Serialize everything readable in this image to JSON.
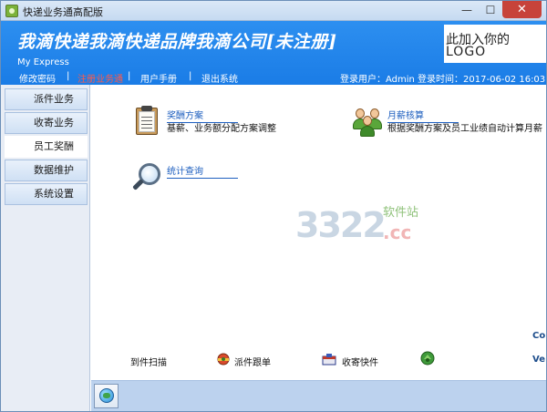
{
  "window": {
    "title": "快递业务通高配版",
    "minimize": "—",
    "maximize": "☐",
    "close": "✕"
  },
  "header": {
    "banner": "我滴快递我滴快递品牌我滴公司[未注册]",
    "subtitle": "My Express",
    "logo_line1": "此加入你的",
    "logo_line2": "LOGO"
  },
  "menu": {
    "items": [
      {
        "label": "修改密码"
      },
      {
        "label": "注册业务通"
      },
      {
        "label": "用户手册"
      },
      {
        "label": "退出系统"
      }
    ],
    "separator": "|",
    "login_info": "登录用户：Admin  登录时间：2017-06-02 16:03:18"
  },
  "sidebar": {
    "items": [
      {
        "label": "派件业务"
      },
      {
        "label": "收寄业务"
      },
      {
        "label": "员工奖酬"
      },
      {
        "label": "数据维护"
      },
      {
        "label": "系统设置"
      }
    ]
  },
  "features": {
    "bonus_plan": {
      "title": "奖酬方案",
      "desc": "基薪、业务额分配方案调整"
    },
    "monthly_pay": {
      "title": "月薪核算",
      "desc": "根据奖酬方案及员工业绩自动计算月薪"
    },
    "stats_query": {
      "title": "统计查询"
    }
  },
  "watermark": {
    "num": "3322",
    "cc": ".cc",
    "text": "软件站"
  },
  "side_edge": {
    "a": "Co",
    "b": "Ve"
  },
  "quickbar": {
    "scan": "到件扫描",
    "track": "派件跟单",
    "collect": "收寄快件"
  },
  "colors": {
    "header_blue": "#1a7ce6",
    "active_menu": "#ff5a4a",
    "link": "#1e5fbf"
  }
}
